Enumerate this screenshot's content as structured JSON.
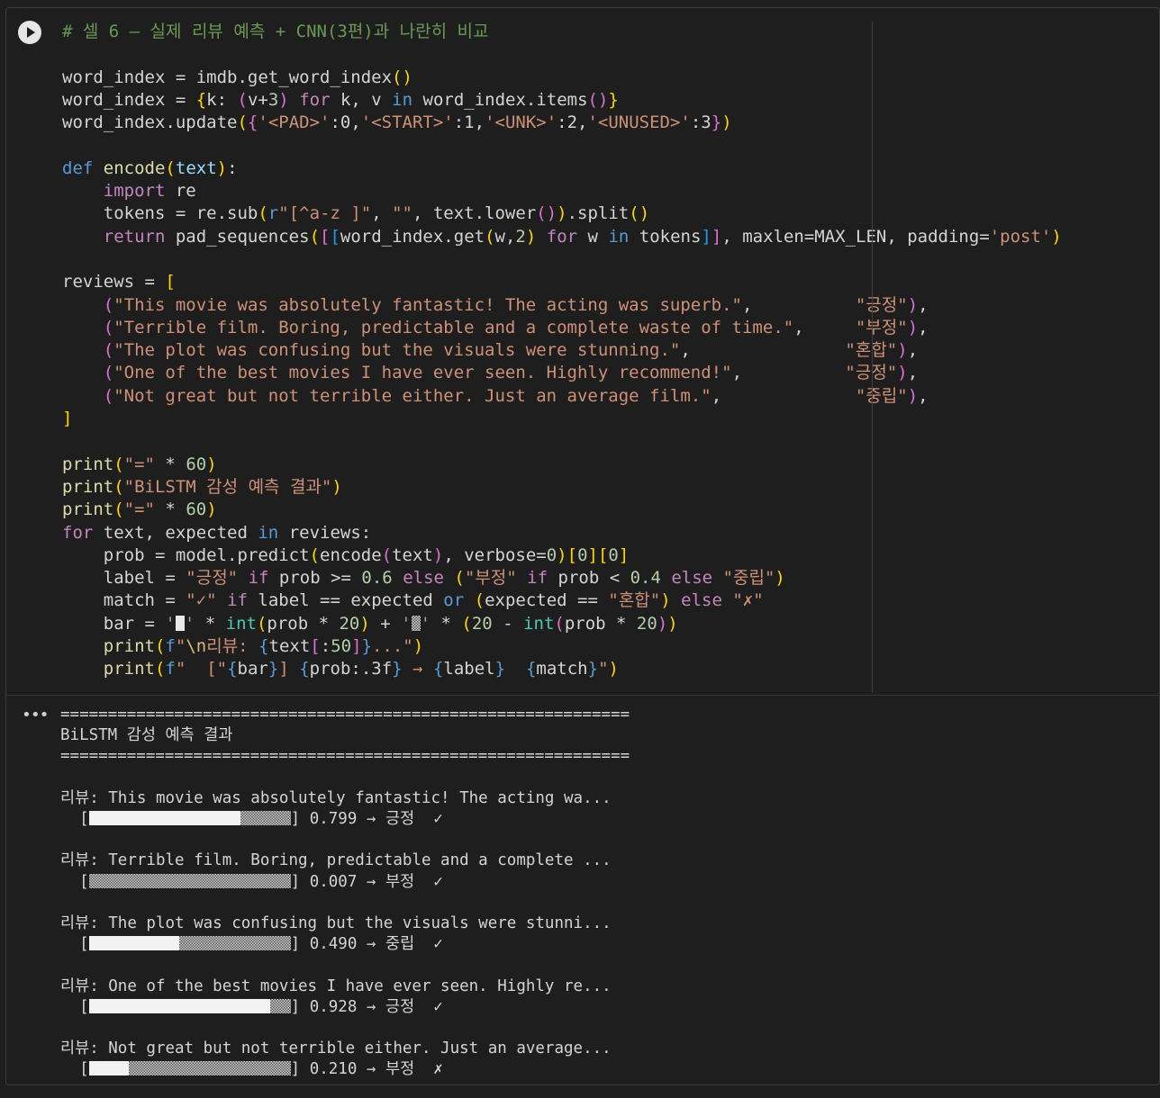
{
  "cell": {
    "run_icon": "play-icon",
    "code_lines": [
      [
        {
          "c": "cm",
          "t": "# 셀 6 — 실제 리뷰 예측 + CNN(3편)과 나란히 비교"
        }
      ],
      [],
      [
        {
          "t": "word_index = imdb.get_word_index"
        },
        {
          "c": "b1",
          "t": "()"
        }
      ],
      [
        {
          "t": "word_index = "
        },
        {
          "c": "b1",
          "t": "{"
        },
        {
          "t": "k: "
        },
        {
          "c": "b2",
          "t": "("
        },
        {
          "t": "v+"
        },
        {
          "c": "nm",
          "t": "3"
        },
        {
          "c": "b2",
          "t": ")"
        },
        {
          "t": " "
        },
        {
          "c": "kc",
          "t": "for"
        },
        {
          "t": " k, v "
        },
        {
          "c": "kw",
          "t": "in"
        },
        {
          "t": " word_index.items"
        },
        {
          "c": "b2",
          "t": "()"
        },
        {
          "c": "b1",
          "t": "}"
        }
      ],
      [
        {
          "t": "word_index.update"
        },
        {
          "c": "b1",
          "t": "("
        },
        {
          "c": "b2",
          "t": "{"
        },
        {
          "c": "st",
          "t": "'<PAD>'"
        },
        {
          "t": ":0,"
        },
        {
          "c": "st",
          "t": "'<START>'"
        },
        {
          "t": ":1,"
        },
        {
          "c": "st",
          "t": "'<UNK>'"
        },
        {
          "t": ":2,"
        },
        {
          "c": "st",
          "t": "'<UNUSED>'"
        },
        {
          "t": ":3"
        },
        {
          "c": "b2",
          "t": "}"
        },
        {
          "c": "b1",
          "t": ")"
        }
      ],
      [],
      [
        {
          "c": "kw",
          "t": "def"
        },
        {
          "t": " "
        },
        {
          "c": "fn",
          "t": "encode"
        },
        {
          "c": "b1",
          "t": "("
        },
        {
          "c": "vr",
          "t": "text"
        },
        {
          "c": "b1",
          "t": ")"
        },
        {
          "t": ":"
        }
      ],
      [
        {
          "t": "    "
        },
        {
          "c": "kc",
          "t": "import"
        },
        {
          "t": " re"
        }
      ],
      [
        {
          "t": "    tokens = re.sub"
        },
        {
          "c": "b1",
          "t": "("
        },
        {
          "c": "kw",
          "t": "r"
        },
        {
          "c": "st",
          "t": "\"[^a-z ]\""
        },
        {
          "t": ", "
        },
        {
          "c": "st",
          "t": "\"\""
        },
        {
          "t": ", text.lower"
        },
        {
          "c": "b2",
          "t": "()"
        },
        {
          "c": "b1",
          "t": ")"
        },
        {
          "t": ".split"
        },
        {
          "c": "b1",
          "t": "()"
        }
      ],
      [
        {
          "t": "    "
        },
        {
          "c": "kc",
          "t": "return"
        },
        {
          "t": " pad_sequences"
        },
        {
          "c": "b1",
          "t": "("
        },
        {
          "c": "b2",
          "t": "["
        },
        {
          "c": "b3",
          "t": "["
        },
        {
          "t": "word_index.get"
        },
        {
          "c": "b1",
          "t": "("
        },
        {
          "t": "w,"
        },
        {
          "c": "nm",
          "t": "2"
        },
        {
          "c": "b1",
          "t": ")"
        },
        {
          "t": " "
        },
        {
          "c": "kc",
          "t": "for"
        },
        {
          "t": " w "
        },
        {
          "c": "kw",
          "t": "in"
        },
        {
          "t": " tokens"
        },
        {
          "c": "b3",
          "t": "]"
        },
        {
          "c": "b2",
          "t": "]"
        },
        {
          "t": ", maxlen=MAX_LEN, padding="
        },
        {
          "c": "st",
          "t": "'post'"
        },
        {
          "c": "b1",
          "t": ")"
        }
      ],
      [],
      [
        {
          "t": "reviews = "
        },
        {
          "c": "b1",
          "t": "["
        }
      ],
      [
        {
          "t": "    "
        },
        {
          "c": "b2",
          "t": "("
        },
        {
          "c": "st",
          "t": "\"This movie was absolutely fantastic! The acting was superb.\""
        },
        {
          "t": ",          "
        },
        {
          "c": "st",
          "t": "\"긍정\""
        },
        {
          "c": "b2",
          "t": ")"
        },
        {
          "t": ","
        }
      ],
      [
        {
          "t": "    "
        },
        {
          "c": "b2",
          "t": "("
        },
        {
          "c": "st",
          "t": "\"Terrible film. Boring, predictable and a complete waste of time.\""
        },
        {
          "t": ",     "
        },
        {
          "c": "st",
          "t": "\"부정\""
        },
        {
          "c": "b2",
          "t": ")"
        },
        {
          "t": ","
        }
      ],
      [
        {
          "t": "    "
        },
        {
          "c": "b2",
          "t": "("
        },
        {
          "c": "st",
          "t": "\"The plot was confusing but the visuals were stunning.\""
        },
        {
          "t": ",               "
        },
        {
          "c": "st",
          "t": "\"혼합\""
        },
        {
          "c": "b2",
          "t": ")"
        },
        {
          "t": ","
        }
      ],
      [
        {
          "t": "    "
        },
        {
          "c": "b2",
          "t": "("
        },
        {
          "c": "st",
          "t": "\"One of the best movies I have ever seen. Highly recommend!\""
        },
        {
          "t": ",          "
        },
        {
          "c": "st",
          "t": "\"긍정\""
        },
        {
          "c": "b2",
          "t": ")"
        },
        {
          "t": ","
        }
      ],
      [
        {
          "t": "    "
        },
        {
          "c": "b2",
          "t": "("
        },
        {
          "c": "st",
          "t": "\"Not great but not terrible either. Just an average film.\""
        },
        {
          "t": ",             "
        },
        {
          "c": "st",
          "t": "\"중립\""
        },
        {
          "c": "b2",
          "t": ")"
        },
        {
          "t": ","
        }
      ],
      [
        {
          "c": "b1",
          "t": "]"
        }
      ],
      [],
      [
        {
          "c": "fn",
          "t": "print"
        },
        {
          "c": "b1",
          "t": "("
        },
        {
          "c": "st",
          "t": "\"=\""
        },
        {
          "t": " * "
        },
        {
          "c": "nm",
          "t": "60"
        },
        {
          "c": "b1",
          "t": ")"
        }
      ],
      [
        {
          "c": "fn",
          "t": "print"
        },
        {
          "c": "b1",
          "t": "("
        },
        {
          "c": "st",
          "t": "\"BiLSTM 감성 예측 결과\""
        },
        {
          "c": "b1",
          "t": ")"
        }
      ],
      [
        {
          "c": "fn",
          "t": "print"
        },
        {
          "c": "b1",
          "t": "("
        },
        {
          "c": "st",
          "t": "\"=\""
        },
        {
          "t": " * "
        },
        {
          "c": "nm",
          "t": "60"
        },
        {
          "c": "b1",
          "t": ")"
        }
      ],
      [
        {
          "c": "kc",
          "t": "for"
        },
        {
          "t": " text, expected "
        },
        {
          "c": "kw",
          "t": "in"
        },
        {
          "t": " reviews:"
        }
      ],
      [
        {
          "t": "    prob = model.predict"
        },
        {
          "c": "b1",
          "t": "("
        },
        {
          "t": "encode"
        },
        {
          "c": "b2",
          "t": "("
        },
        {
          "t": "text"
        },
        {
          "c": "b2",
          "t": ")"
        },
        {
          "t": ", verbose="
        },
        {
          "c": "nm",
          "t": "0"
        },
        {
          "c": "b1",
          "t": ")"
        },
        {
          "c": "b1",
          "t": "["
        },
        {
          "c": "nm",
          "t": "0"
        },
        {
          "c": "b1",
          "t": "]["
        },
        {
          "c": "nm",
          "t": "0"
        },
        {
          "c": "b1",
          "t": "]"
        }
      ],
      [
        {
          "t": "    label = "
        },
        {
          "c": "st",
          "t": "\"긍정\""
        },
        {
          "t": " "
        },
        {
          "c": "kc",
          "t": "if"
        },
        {
          "t": " prob >= "
        },
        {
          "c": "nm",
          "t": "0.6"
        },
        {
          "t": " "
        },
        {
          "c": "kc",
          "t": "else"
        },
        {
          "t": " "
        },
        {
          "c": "b1",
          "t": "("
        },
        {
          "c": "st",
          "t": "\"부정\""
        },
        {
          "t": " "
        },
        {
          "c": "kc",
          "t": "if"
        },
        {
          "t": " prob < "
        },
        {
          "c": "nm",
          "t": "0.4"
        },
        {
          "t": " "
        },
        {
          "c": "kc",
          "t": "else"
        },
        {
          "t": " "
        },
        {
          "c": "st",
          "t": "\"중립\""
        },
        {
          "c": "b1",
          "t": ")"
        }
      ],
      [
        {
          "t": "    match = "
        },
        {
          "c": "st",
          "t": "\"✓\""
        },
        {
          "t": " "
        },
        {
          "c": "kc",
          "t": "if"
        },
        {
          "t": " label == expected "
        },
        {
          "c": "kw",
          "t": "or"
        },
        {
          "t": " "
        },
        {
          "c": "b1",
          "t": "("
        },
        {
          "t": "expected == "
        },
        {
          "c": "st",
          "t": "\"혼합\""
        },
        {
          "c": "b1",
          "t": ")"
        },
        {
          "t": " "
        },
        {
          "c": "kc",
          "t": "else"
        },
        {
          "t": " "
        },
        {
          "c": "st",
          "t": "\"✗\""
        }
      ],
      [
        {
          "t": "    bar = "
        },
        {
          "c": "st",
          "t": "'"
        },
        {
          "chip": "full"
        },
        {
          "c": "st",
          "t": "'"
        },
        {
          "t": " * "
        },
        {
          "c": "bi",
          "t": "int"
        },
        {
          "c": "b1",
          "t": "("
        },
        {
          "t": "prob * "
        },
        {
          "c": "nm",
          "t": "20"
        },
        {
          "c": "b1",
          "t": ")"
        },
        {
          "t": " + "
        },
        {
          "c": "st",
          "t": "'"
        },
        {
          "chip": "shade"
        },
        {
          "c": "st",
          "t": "'"
        },
        {
          "t": " * "
        },
        {
          "c": "b1",
          "t": "("
        },
        {
          "c": "nm",
          "t": "20"
        },
        {
          "t": " - "
        },
        {
          "c": "bi",
          "t": "int"
        },
        {
          "c": "b2",
          "t": "("
        },
        {
          "t": "prob * "
        },
        {
          "c": "nm",
          "t": "20"
        },
        {
          "c": "b2",
          "t": ")"
        },
        {
          "c": "b1",
          "t": ")"
        }
      ],
      [
        {
          "t": "    "
        },
        {
          "c": "fn",
          "t": "print"
        },
        {
          "c": "b1",
          "t": "("
        },
        {
          "c": "kw",
          "t": "f"
        },
        {
          "c": "st",
          "t": "\""
        },
        {
          "c": "es",
          "t": "\\n"
        },
        {
          "c": "st",
          "t": "리뷰: "
        },
        {
          "c": "kw",
          "t": "{"
        },
        {
          "t": "text"
        },
        {
          "c": "b2",
          "t": "["
        },
        {
          "t": ":"
        },
        {
          "c": "nm",
          "t": "50"
        },
        {
          "c": "b2",
          "t": "]"
        },
        {
          "c": "kw",
          "t": "}"
        },
        {
          "c": "st",
          "t": "...\""
        },
        {
          "c": "b1",
          "t": ")"
        }
      ],
      [
        {
          "t": "    "
        },
        {
          "c": "fn",
          "t": "print"
        },
        {
          "c": "b1",
          "t": "("
        },
        {
          "c": "kw",
          "t": "f"
        },
        {
          "c": "st",
          "t": "\"  [\""
        },
        {
          "c": "kw",
          "t": "{"
        },
        {
          "t": "bar"
        },
        {
          "c": "kw",
          "t": "}"
        },
        {
          "c": "st",
          "t": "] "
        },
        {
          "c": "kw",
          "t": "{"
        },
        {
          "t": "prob:.3f"
        },
        {
          "c": "kw",
          "t": "}"
        },
        {
          "c": "st",
          "t": " → "
        },
        {
          "c": "kw",
          "t": "{"
        },
        {
          "t": "label"
        },
        {
          "c": "kw",
          "t": "}"
        },
        {
          "c": "st",
          "t": "  "
        },
        {
          "c": "kw",
          "t": "{"
        },
        {
          "t": "match"
        },
        {
          "c": "kw",
          "t": "}"
        },
        {
          "c": "st",
          "t": "\""
        },
        {
          "c": "b1",
          "t": ")"
        }
      ]
    ]
  },
  "output": {
    "menu_icon": "ellipsis-icon",
    "menu_label": "•••",
    "separator": "============================================================",
    "header": "BiLSTM 감성 예측 결과",
    "results": [
      {
        "review": "리뷰: This movie was absolutely fantastic! The acting wa...",
        "prob": 0.799,
        "prob_text": "0.799",
        "label": "긍정",
        "match": "✓"
      },
      {
        "review": "리뷰: Terrible film. Boring, predictable and a complete ...",
        "prob": 0.007,
        "prob_text": "0.007",
        "label": "부정",
        "match": "✓"
      },
      {
        "review": "리뷰: The plot was confusing but the visuals were stunni...",
        "prob": 0.49,
        "prob_text": "0.490",
        "label": "중립",
        "match": "✓"
      },
      {
        "review": "리뷰: One of the best movies I have ever seen. Highly re...",
        "prob": 0.928,
        "prob_text": "0.928",
        "label": "긍정",
        "match": "✓"
      },
      {
        "review": "리뷰: Not great but not terrible either. Just an average...",
        "prob": 0.21,
        "prob_text": "0.210",
        "label": "부정",
        "match": "✗"
      }
    ]
  }
}
